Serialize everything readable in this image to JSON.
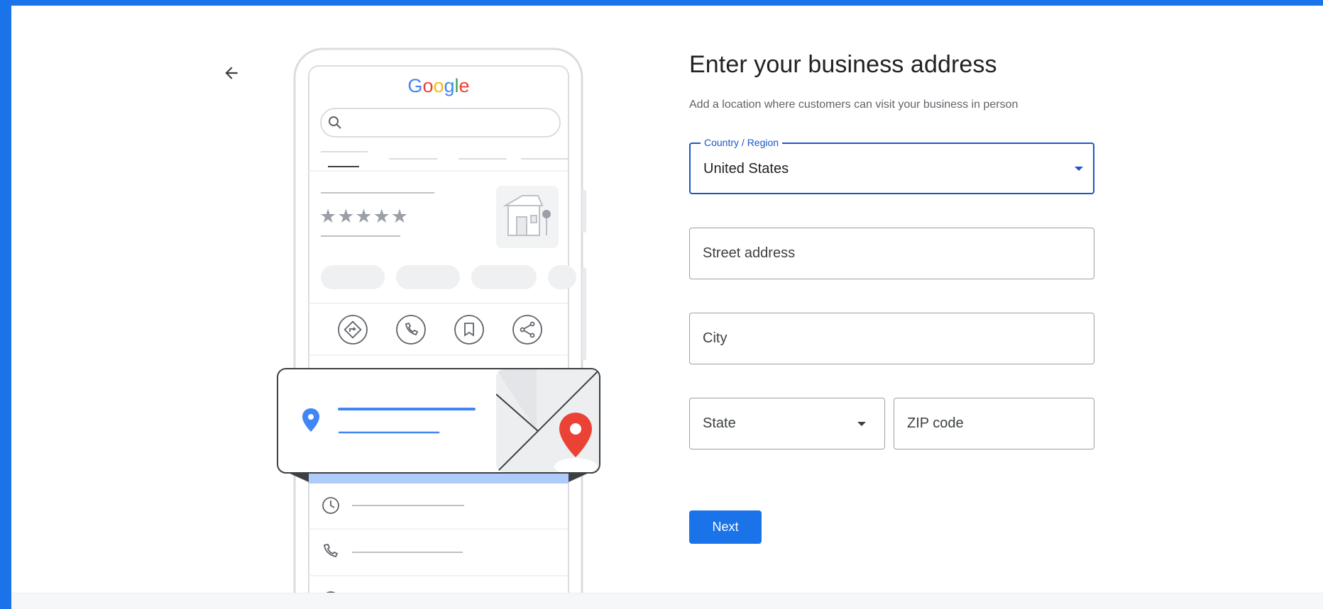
{
  "brand": {
    "google_logo_text": "Google"
  },
  "form": {
    "title": "Enter your business address",
    "subtitle": "Add a location where customers can visit your business in person",
    "country": {
      "label": "Country / Region",
      "value": "United States"
    },
    "street": {
      "placeholder": "Street address",
      "value": ""
    },
    "city": {
      "placeholder": "City",
      "value": ""
    },
    "state": {
      "placeholder": "State"
    },
    "zip": {
      "placeholder": "ZIP code",
      "value": ""
    },
    "next_label": "Next"
  },
  "illustration": {
    "rating_stars": "★★★★★"
  },
  "colors": {
    "accent": "#1a73e8",
    "focus_border": "#1a57c6",
    "pin_blue": "#4285f4",
    "pin_red": "#ea4335"
  }
}
